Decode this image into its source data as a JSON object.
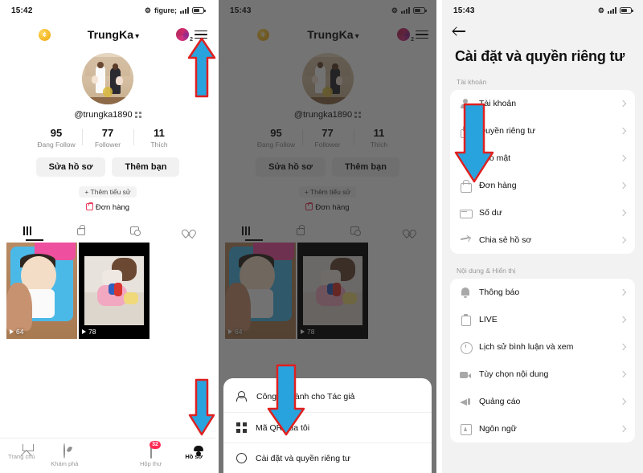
{
  "panel1": {
    "status": {
      "time": "15:42",
      "icons": [
        "bluetooth-icon",
        "mute-icon",
        "signal-icon",
        "battery-icon"
      ]
    },
    "header": {
      "coin_label": "¢",
      "username": "TrungKa",
      "chevron": "⌄",
      "avatar_count": "2"
    },
    "handle": "@trungka1890",
    "stats": [
      {
        "num": "95",
        "label": "Đang Follow"
      },
      {
        "num": "77",
        "label": "Follower"
      },
      {
        "num": "11",
        "label": "Thích"
      }
    ],
    "buttons": {
      "edit": "Sửa hồ sơ",
      "add_friend": "Thêm bạn"
    },
    "bio_chip": "+ Thêm tiểu sử",
    "order": "Đơn hàng",
    "videos": [
      {
        "plays": "64"
      },
      {
        "plays": "78"
      }
    ],
    "nav": [
      {
        "label": "Trang chủ",
        "icon": "home-icon",
        "active": false
      },
      {
        "label": "Khám phá",
        "icon": "compass-icon",
        "active": false
      },
      {
        "label": "",
        "icon": "plus-icon",
        "active": false
      },
      {
        "label": "Hộp thư",
        "icon": "inbox-icon",
        "badge": "32",
        "active": false
      },
      {
        "label": "Hồ sơ",
        "icon": "person-icon",
        "active": true
      }
    ]
  },
  "panel2": {
    "status": {
      "time": "15:43"
    },
    "header": {
      "coin_label": "¢",
      "username": "TrungKa",
      "chevron": "⌄",
      "avatar_count": "2"
    },
    "handle": "@trungka1890",
    "stats": [
      {
        "num": "95",
        "label": "Đang Follow"
      },
      {
        "num": "77",
        "label": "Follower"
      },
      {
        "num": "11",
        "label": "Thích"
      }
    ],
    "buttons": {
      "edit": "Sửa hồ sơ",
      "add_friend": "Thêm bạn"
    },
    "bio_chip": "+ Thêm tiểu sử",
    "order": "Đơn hàng",
    "videos": [
      {
        "plays": "64"
      },
      {
        "plays": "78"
      }
    ],
    "sheet": [
      {
        "label": "Công cụ dành cho Tác giả",
        "icon": "creator-tools-icon"
      },
      {
        "label": "Mã QR của tôi",
        "icon": "qr-code-icon"
      },
      {
        "label": "Cài đặt và quyền riêng tư",
        "icon": "gear-icon"
      }
    ]
  },
  "panel3": {
    "status": {
      "time": "15:43"
    },
    "back_icon": "back-arrow-icon",
    "title": "Cài đặt và quyền riêng tư",
    "sections": [
      {
        "label": "Tài khoản",
        "rows": [
          {
            "label": "Tài khoản",
            "icon": "person-icon"
          },
          {
            "label": "Quyền riêng tư",
            "icon": "lock-icon"
          },
          {
            "label": "Bảo mật",
            "icon": "shield-icon"
          },
          {
            "label": "Đơn hàng",
            "icon": "bag-icon"
          },
          {
            "label": "Số dư",
            "icon": "wallet-icon"
          },
          {
            "label": "Chia sẻ hồ sơ",
            "icon": "share-icon"
          }
        ]
      },
      {
        "label": "Nội dung & Hiển thị",
        "rows": [
          {
            "label": "Thông báo",
            "icon": "bell-icon"
          },
          {
            "label": "LIVE",
            "icon": "live-icon"
          },
          {
            "label": "Lịch sử bình luận và xem",
            "icon": "clock-icon"
          },
          {
            "label": "Tùy chọn nội dung",
            "icon": "video-icon"
          },
          {
            "label": "Quảng cáo",
            "icon": "ad-icon"
          },
          {
            "label": "Ngôn ngữ",
            "icon": "language-icon"
          }
        ]
      }
    ]
  },
  "annotations": {
    "arrow_color": "#29a3dd",
    "arrow_stroke": "#e02020",
    "arrows": [
      {
        "name": "arrow-to-hamburger-menu",
        "direction": "up"
      },
      {
        "name": "arrow-to-profile-tab",
        "direction": "down"
      },
      {
        "name": "arrow-to-settings-menu-item",
        "direction": "down"
      },
      {
        "name": "arrow-to-security-setting",
        "direction": "down"
      }
    ]
  }
}
